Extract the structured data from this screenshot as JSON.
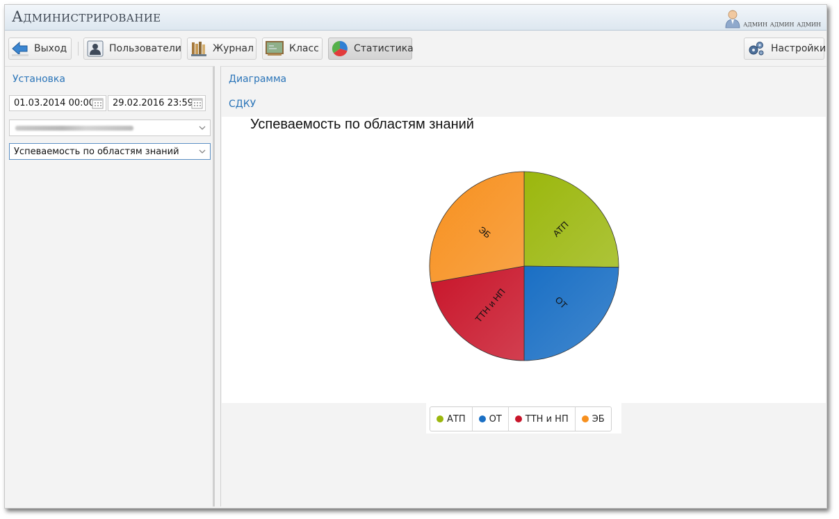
{
  "header": {
    "title": "Администрирование",
    "user": "админ админ админ"
  },
  "toolbar": {
    "buttons": [
      {
        "label": "Выход",
        "icon": "exit-arrow-icon"
      },
      {
        "label": "Пользователи",
        "icon": "users-icon"
      },
      {
        "label": "Журнал",
        "icon": "journal-icon"
      },
      {
        "label": "Класс",
        "icon": "classroom-board-icon"
      },
      {
        "label": "Статистика",
        "icon": "pie-chart-icon",
        "active": true
      }
    ],
    "settings_label": "Настройки"
  },
  "left": {
    "section_link": "Установка",
    "date_from": "01.03.2014 00:00",
    "date_to": "29.02.2016 23:59",
    "report_select": "Успеваемость по областям знаний"
  },
  "right": {
    "diagram_link": "Диаграмма",
    "sdku_link": "СДКУ"
  },
  "colors": {
    "accent_link": "#2a74b8",
    "atp": "#9bb70d",
    "ot": "#1a6fc4",
    "ttn": "#c8152a",
    "eb": "#f7901e"
  },
  "chart_data": {
    "type": "pie",
    "title": "Успеваемость по областям знаний",
    "slices": [
      {
        "label": "АТП",
        "value": 25.2,
        "color": "#9bb70d"
      },
      {
        "label": "ОТ",
        "value": 24.8,
        "color": "#1a6fc4"
      },
      {
        "label": "ТТН и НП",
        "value": 22.2,
        "color": "#c8152a"
      },
      {
        "label": "ЭБ",
        "value": 27.8,
        "color": "#f7901e"
      }
    ],
    "legend": [
      "АТП",
      "ОТ",
      "ТТН и НП",
      "ЭБ"
    ],
    "legend_position": "bottom"
  }
}
